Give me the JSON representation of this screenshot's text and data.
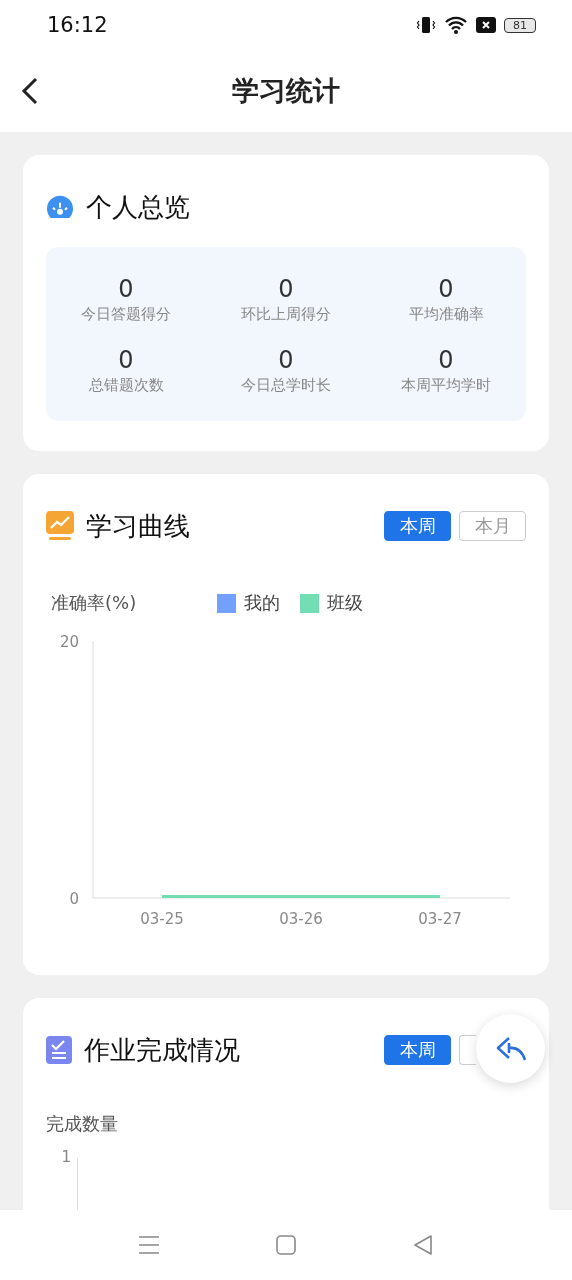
{
  "status_bar": {
    "time": "16:12",
    "battery": "81"
  },
  "header": {
    "title": "学习统计"
  },
  "overview": {
    "title": "个人总览",
    "stats": [
      {
        "value": "0",
        "label": "今日答题得分"
      },
      {
        "value": "0",
        "label": "环比上周得分"
      },
      {
        "value": "0",
        "label": "平均准确率"
      },
      {
        "value": "0",
        "label": "总错题次数"
      },
      {
        "value": "0",
        "label": "今日总学时长"
      },
      {
        "value": "0",
        "label": "本周平均学时"
      }
    ]
  },
  "learning_curve": {
    "title": "学习曲线",
    "tabs": [
      {
        "label": "本周",
        "selected": true
      },
      {
        "label": "本月",
        "selected": false
      }
    ],
    "chart_data": {
      "type": "line",
      "legend": true,
      "ylabel": "准确率(%)",
      "categories": [
        "03-25",
        "03-26",
        "03-27"
      ],
      "ylim": [
        0,
        20
      ],
      "yticks": [
        0,
        20
      ],
      "series": [
        {
          "name": "我的",
          "color": "#73a0fa",
          "values": [
            null,
            null,
            null
          ]
        },
        {
          "name": "班级",
          "color": "#73deb3",
          "values": [
            0,
            0,
            0
          ]
        }
      ]
    }
  },
  "homework": {
    "title": "作业完成情况",
    "tabs": [
      {
        "label": "本周",
        "selected": true
      },
      {
        "selected": false
      }
    ],
    "axis": {
      "ylabel": "完成数量",
      "ytick": "1"
    }
  }
}
